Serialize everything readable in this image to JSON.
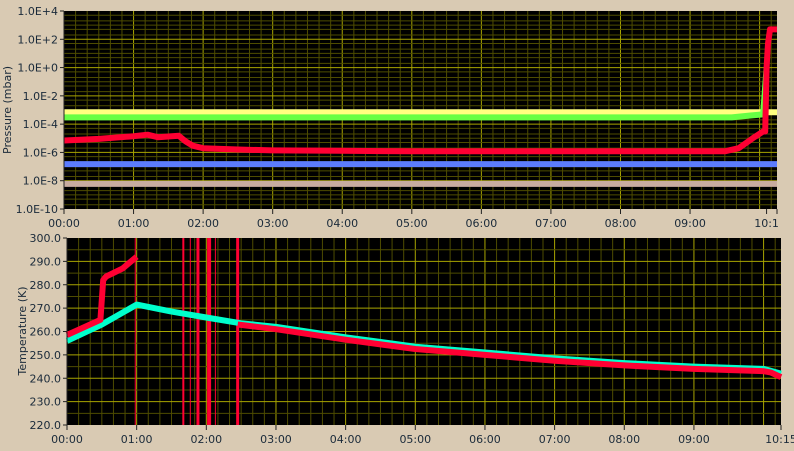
{
  "colors": {
    "background": "#d9cab3",
    "plot_bg": "#000000",
    "grid_major": "#a8a400",
    "grid_minor": "#4e4c00"
  },
  "chart_data": [
    {
      "type": "line",
      "title": "",
      "xlabel": "",
      "ylabel": "Pressure (mbar)",
      "yscale": "log",
      "xlim_hours": [
        0,
        10.25
      ],
      "ylim": [
        1e-10,
        10000.0
      ],
      "grid": true,
      "x_tick_labels": [
        "00:00",
        "01:00",
        "02:00",
        "03:00",
        "04:00",
        "05:00",
        "06:00",
        "07:00",
        "08:00",
        "09:00",
        "10:1"
      ],
      "y_tick_labels": [
        "1.0E+4",
        "1.0E+2",
        "1.0E+0",
        "1.0E-2",
        "1.0E-4",
        "1.0E-6",
        "1.0E-8",
        "1.0E-10"
      ],
      "series": [
        {
          "name": "gauge-yellow",
          "color": "#ffff80",
          "width": 6,
          "x": [
            0,
            10.25
          ],
          "y": [
            0.0007,
            0.0007
          ]
        },
        {
          "name": "gauge-green",
          "color": "#66ff44",
          "width": 6,
          "x": [
            0,
            9.6,
            9.85,
            10.05,
            10.07,
            10.1
          ],
          "y": [
            0.0003,
            0.0003,
            0.0004,
            0.0005,
            0.01,
            1
          ]
        },
        {
          "name": "gauge-red",
          "color": "#ff0033",
          "width": 6,
          "x": [
            0,
            0.5,
            1.0,
            1.2,
            1.35,
            1.65,
            1.75,
            1.85,
            2.0,
            2.5,
            3.0,
            4.0,
            5.0,
            6.0,
            7.0,
            8.0,
            9.0,
            9.5,
            9.7,
            9.9,
            10.05,
            10.08,
            10.1,
            10.12,
            10.15,
            10.25
          ],
          "y": [
            7e-06,
            9e-06,
            1.4e-05,
            1.8e-05,
            1.2e-05,
            1.5e-05,
            6e-06,
            3e-06,
            2e-06,
            1.6e-06,
            1.4e-06,
            1.3e-06,
            1.2e-06,
            1.2e-06,
            1.2e-06,
            1.2e-06,
            1.2e-06,
            1.2e-06,
            2e-06,
            1e-05,
            3e-05,
            3e-05,
            1,
            50,
            500,
            500
          ]
        },
        {
          "name": "gauge-blue",
          "color": "#5c7cff",
          "width": 6,
          "x": [
            0,
            10.25
          ],
          "y": [
            1.5e-07,
            1.5e-07
          ]
        },
        {
          "name": "gauge-tan",
          "color": "#c8aca0",
          "width": 6,
          "x": [
            0,
            10.25
          ],
          "y": [
            6e-09,
            6e-09
          ]
        }
      ]
    },
    {
      "type": "line",
      "title": "",
      "xlabel": "",
      "ylabel": "Temperature (K)",
      "xlim_hours": [
        0,
        10.25
      ],
      "ylim": [
        220,
        300
      ],
      "grid": true,
      "x_tick_labels": [
        "00:00",
        "01:00",
        "02:00",
        "03:00",
        "04:00",
        "05:00",
        "06:00",
        "07:00",
        "08:00",
        "09:00",
        "10:15"
      ],
      "y_tick_labels": [
        "300.0",
        "290.0",
        "280.0",
        "270.0",
        "260.0",
        "250.0",
        "240.0",
        "230.0",
        "220.0"
      ],
      "series": [
        {
          "name": "temp-cyan",
          "color": "#00ffcc",
          "width": 6,
          "x": [
            0,
            0.5,
            1.0,
            1.5,
            2.0,
            2.5,
            3.0,
            4.0,
            5.0,
            6.0,
            7.0,
            8.0,
            9.0,
            10.0,
            10.25
          ],
          "y": [
            256,
            263,
            271.5,
            268.5,
            266,
            263.5,
            262,
            257.5,
            253.5,
            251,
            248.5,
            246.5,
            245,
            244,
            242
          ]
        },
        {
          "name": "temp-red",
          "color": "#ff0033",
          "width": 6,
          "x": [
            0,
            0.48,
            0.52,
            0.56,
            0.8,
            1.0
          ],
          "y": [
            258.5,
            265,
            282,
            283.5,
            287,
            292
          ]
        },
        {
          "name": "temp-red-2",
          "color": "#ff0033",
          "width": 6,
          "x": [
            2.45,
            3.0,
            4.0,
            5.0,
            6.0,
            7.0,
            8.0,
            9.0,
            10.0,
            10.1,
            10.25
          ],
          "y": [
            263,
            261,
            256.5,
            252.5,
            250,
            247.5,
            245.5,
            244,
            243,
            242.5,
            240.5
          ]
        }
      ],
      "spikes_hours": [
        {
          "x": 0.98,
          "w": 1
        },
        {
          "x": 1.67,
          "w": 2
        },
        {
          "x": 1.77,
          "w": 1
        },
        {
          "x": 1.88,
          "w": 3
        },
        {
          "x": 2.04,
          "w": 4
        },
        {
          "x": 2.13,
          "w": 1
        },
        {
          "x": 2.45,
          "w": 3
        }
      ]
    }
  ]
}
